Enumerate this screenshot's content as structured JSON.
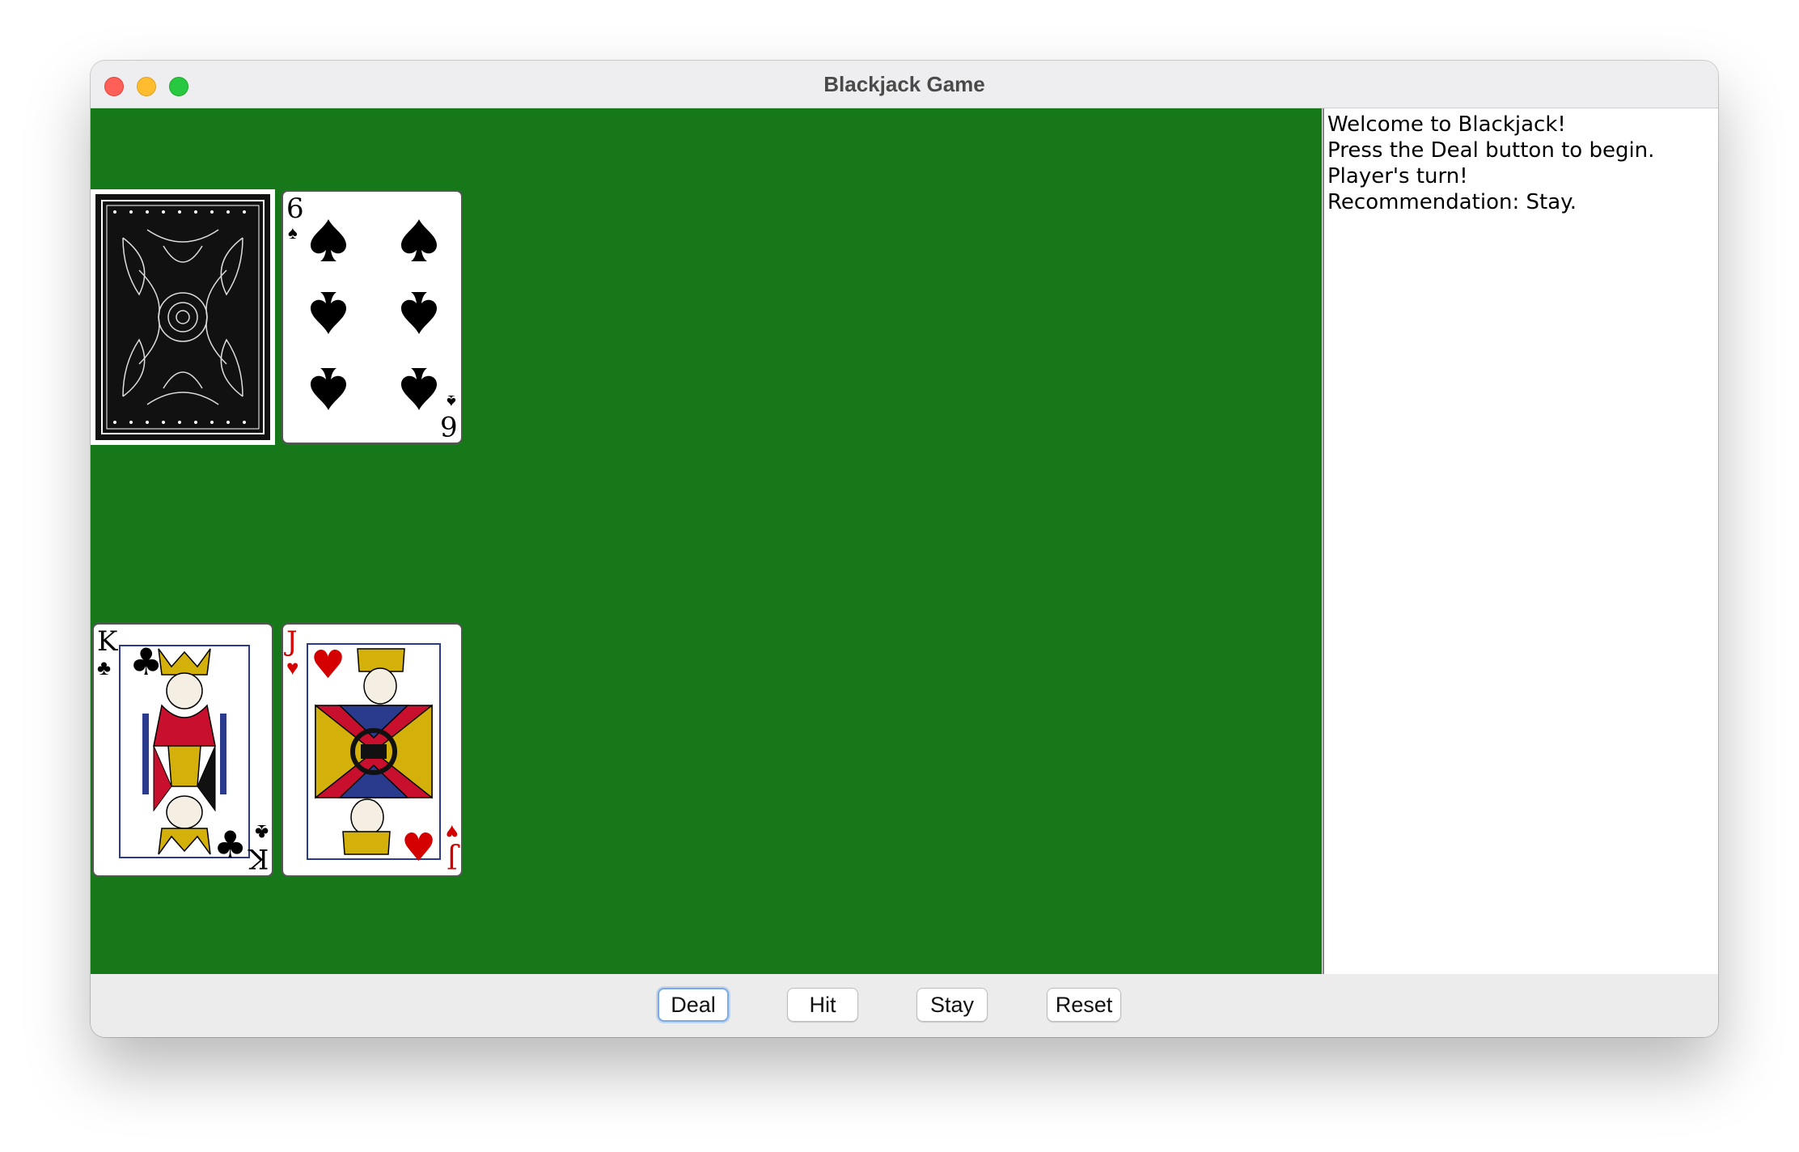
{
  "window": {
    "title": "Blackjack Game"
  },
  "dealer": {
    "cards": [
      {
        "face": "back"
      },
      {
        "rank": "6",
        "suit": "spades",
        "suit_symbol": "♠",
        "color": "#000000"
      }
    ]
  },
  "player": {
    "cards": [
      {
        "rank": "K",
        "suit": "clubs",
        "suit_symbol": "♣",
        "color": "#000000"
      },
      {
        "rank": "J",
        "suit": "hearts",
        "suit_symbol": "♥",
        "color": "#d40000"
      }
    ]
  },
  "log": {
    "lines": [
      "Welcome to Blackjack!",
      "Press the Deal button to begin.",
      "Player's turn!",
      "Recommendation: Stay."
    ]
  },
  "buttons": {
    "deal": "Deal",
    "hit": "Hit",
    "stay": "Stay",
    "reset": "Reset"
  },
  "colors": {
    "table_felt": "#17781a",
    "focus_ring": "#7aaae8"
  }
}
